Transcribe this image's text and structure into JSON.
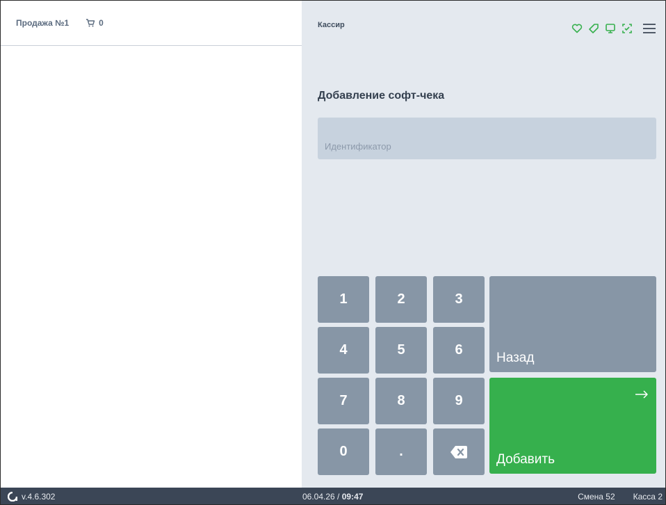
{
  "sale": {
    "tab_label": "Продажа №1",
    "cart_count": "0"
  },
  "header": {
    "role": "Кассир",
    "icons": [
      "heart-icon",
      "tag-icon",
      "monitor-icon",
      "scan-icon",
      "menu-icon"
    ],
    "icon_color": "#36b04d"
  },
  "form": {
    "title": "Добавление софт-чека",
    "identifier_placeholder": "Идентификатор",
    "identifier_value": ""
  },
  "keypad": {
    "keys": {
      "k1": "1",
      "k2": "2",
      "k3": "3",
      "k4": "4",
      "k5": "5",
      "k6": "6",
      "k7": "7",
      "k8": "8",
      "k9": "9",
      "k0": "0",
      "dot": "."
    },
    "back_label": "Назад",
    "add_label": "Добавить",
    "add_color": "#36b04d",
    "key_color": "#8796a6"
  },
  "statusbar": {
    "version": "v.4.6.302",
    "date": "06.04.26",
    "separator": " / ",
    "time": "09:47",
    "shift": "Смена 52",
    "register": "Касса 2"
  }
}
